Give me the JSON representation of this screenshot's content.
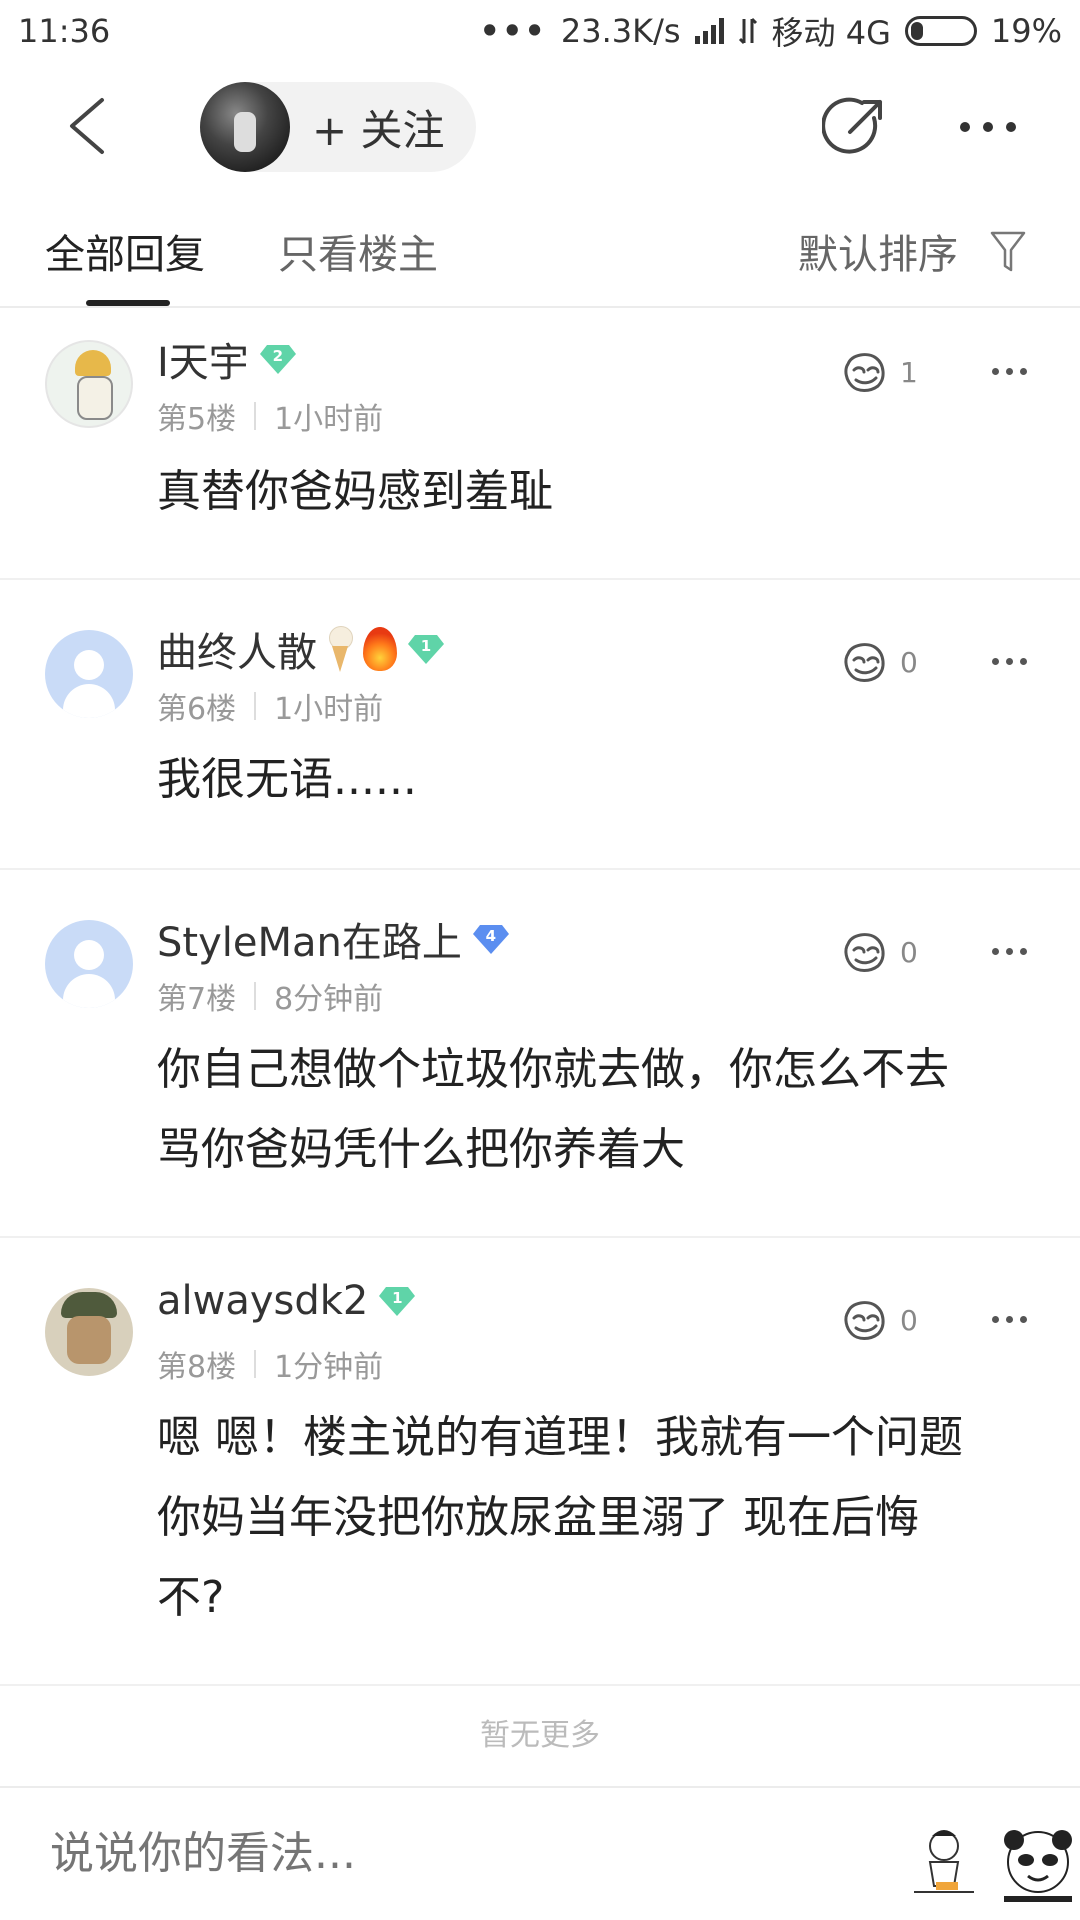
{
  "status_bar": {
    "time": "11:36",
    "dots": "•••",
    "speed": "23.3K/s",
    "carrier": "移动 4G",
    "battery": "19%"
  },
  "header": {
    "follow_label": "+ 关注",
    "icons": [
      "back-arrow-icon",
      "share-icon",
      "more-icon"
    ]
  },
  "tabs": {
    "all_replies": "全部回复",
    "only_op": "只看楼主",
    "sort": "默认排序"
  },
  "comments": [
    {
      "username": "I天宇",
      "badge": "2",
      "floor": "第5楼",
      "time": "1小时前",
      "text": "真替你爸妈感到羞耻",
      "likes": "1"
    },
    {
      "username": "曲终人散",
      "badge": "1",
      "floor": "第6楼",
      "time": "1小时前",
      "text": "我很无语......",
      "likes": "0"
    },
    {
      "username": "StyleMan在路上",
      "badge": "4",
      "floor": "第7楼",
      "time": "8分钟前",
      "text_line1": "你自己想做个垃圾你就去做，你怎么不去",
      "text_line2": "骂你爸妈凭什么把你养着大",
      "likes": "0"
    },
    {
      "username": "alwaysdk2",
      "badge": "1",
      "floor": "第8楼",
      "time": "1分钟前",
      "text_line1": "嗯 嗯！楼主说的有道理！我就有一个问题",
      "text_line2": "你妈当年没把你放尿盆里溺了 现在后悔",
      "text_line3": "不?",
      "likes": "0"
    }
  ],
  "no_more": "暂无更多",
  "bottom": {
    "input_placeholder": "说说你的看法..."
  },
  "colors": {
    "badge_green": "#5fd4a8",
    "badge_blue": "#5b8ef0",
    "text_primary": "#222222",
    "text_muted": "#999999"
  }
}
